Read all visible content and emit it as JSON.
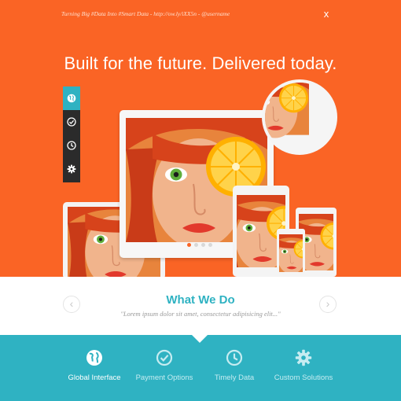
{
  "tweet": {
    "text": "Turning Big #Data Into #Smart Data - http://ow.ly/iXX5n - @username",
    "close_label": "x"
  },
  "hero": {
    "headline": "Built for the future. Delivered today."
  },
  "dock": {
    "items": [
      {
        "icon": "globe-icon",
        "active": true
      },
      {
        "icon": "check-circle-icon",
        "active": false
      },
      {
        "icon": "clock-icon",
        "active": false
      },
      {
        "icon": "gear-icon",
        "active": false
      }
    ]
  },
  "slider": {
    "dot_count": 4,
    "active_index": 0
  },
  "section": {
    "title": "What We Do",
    "subtitle": "\"Lorem ipsum dolor sit amet, consectetur adipisicing elit...\"",
    "prev_label": "‹",
    "next_label": "›"
  },
  "tabs": [
    {
      "label": "Global Interface",
      "icon": "globe-icon",
      "active": true
    },
    {
      "label": "Payment Options",
      "icon": "check-circle-icon",
      "active": false
    },
    {
      "label": "Timely Data",
      "icon": "clock-icon",
      "active": false
    },
    {
      "label": "Custom Solutions",
      "icon": "gear-icon",
      "active": false
    }
  ],
  "colors": {
    "hero_orange": "#fa6425",
    "teal": "#2fb2c2",
    "dock_dark": "#2b2b2b",
    "white": "#ffffff"
  }
}
